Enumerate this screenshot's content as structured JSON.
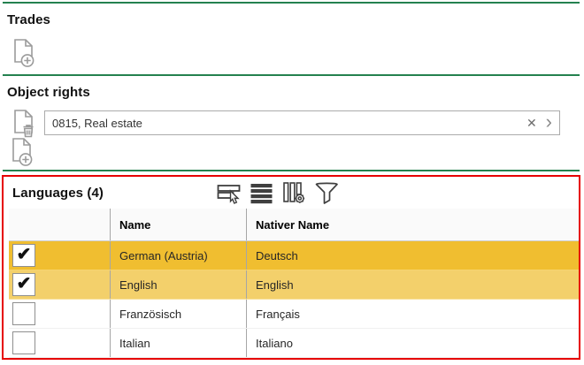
{
  "trades": {
    "title": "Trades"
  },
  "object_rights": {
    "title": "Object rights",
    "field": {
      "value": "0815, Real estate"
    },
    "clear_glyph": "✕",
    "open_glyph": "›"
  },
  "languages": {
    "title": "Languages (4)",
    "toolbar_icons": [
      "select-rows",
      "row-list",
      "column-settings",
      "filter"
    ],
    "columns": {
      "name": "Name",
      "native": "Nativer Name"
    },
    "rows": [
      {
        "check": "✔",
        "name": "German (Austria)",
        "native": "Deutsch",
        "state": "selected"
      },
      {
        "check": "✔",
        "name": "English",
        "native": "English",
        "state": "checked"
      },
      {
        "check": "",
        "name": "Französisch",
        "native": "Français",
        "state": "unchecked"
      },
      {
        "check": "",
        "name": "Italian",
        "native": "Italiano",
        "state": "unchecked"
      }
    ]
  },
  "colors": {
    "accent_green": "#24814F",
    "highlight_red": "#E60000",
    "row_selected": "#F0BE30",
    "row_checked": "#F3D06B",
    "icon_gray": "#9B9B9B",
    "toolbar_icon": "#3F3F3F"
  }
}
